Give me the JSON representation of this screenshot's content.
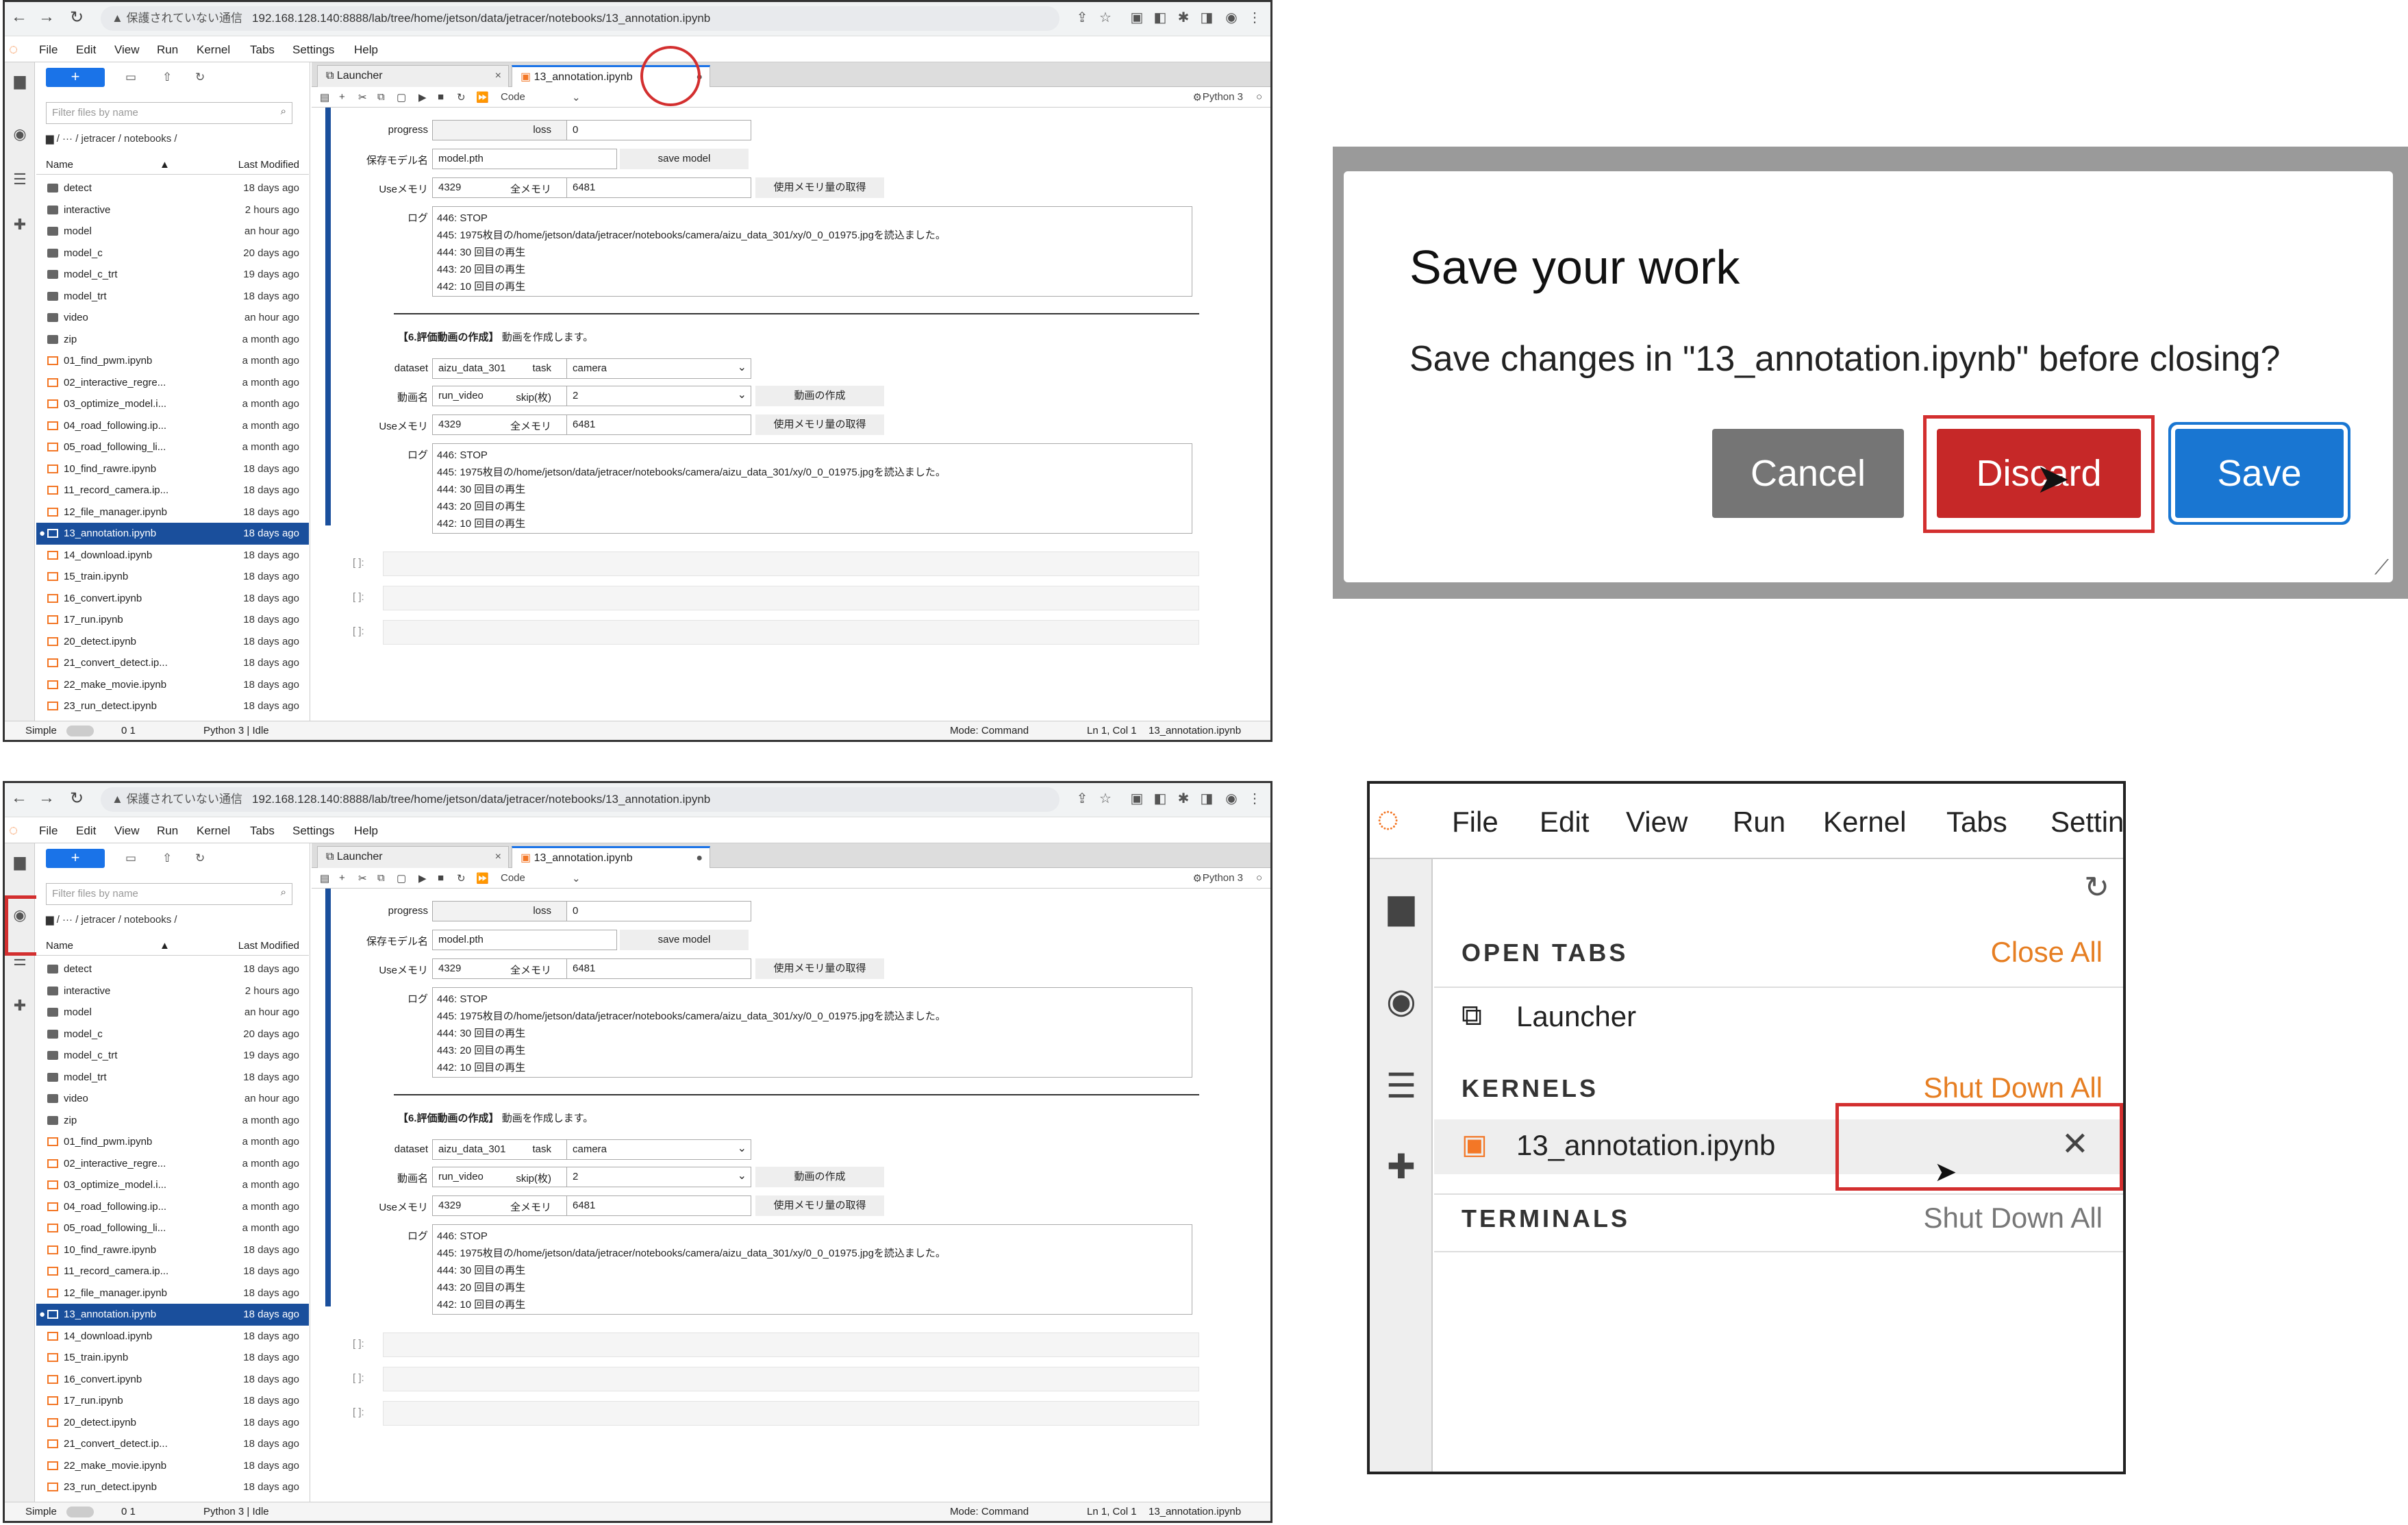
{
  "browser": {
    "url_warning": "▲ 保護されていない通信",
    "url": "192.168.128.140:8888/lab/tree/home/jetson/data/jetracer/notebooks/13_annotation.ipynb"
  },
  "menu": [
    "File",
    "Edit",
    "View",
    "Run",
    "Kernel",
    "Tabs",
    "Settings",
    "Help"
  ],
  "filebrowser": {
    "filter_placeholder": "Filter files by name",
    "breadcrumb": "/ ··· / jetracer / notebooks /",
    "col_name": "Name",
    "col_modified": "Last Modified",
    "files": [
      {
        "name": "detect",
        "modified": "18 days ago",
        "type": "folder"
      },
      {
        "name": "interactive",
        "modified": "2 hours ago",
        "type": "folder"
      },
      {
        "name": "model",
        "modified": "an hour ago",
        "type": "folder"
      },
      {
        "name": "model_c",
        "modified": "20 days ago",
        "type": "folder"
      },
      {
        "name": "model_c_trt",
        "modified": "19 days ago",
        "type": "folder"
      },
      {
        "name": "model_trt",
        "modified": "18 days ago",
        "type": "folder"
      },
      {
        "name": "video",
        "modified": "an hour ago",
        "type": "folder"
      },
      {
        "name": "zip",
        "modified": "a month ago",
        "type": "folder"
      },
      {
        "name": "01_find_pwm.ipynb",
        "modified": "a month ago",
        "type": "nb"
      },
      {
        "name": "02_interactive_regre...",
        "modified": "a month ago",
        "type": "nb"
      },
      {
        "name": "03_optimize_model.i...",
        "modified": "a month ago",
        "type": "nb"
      },
      {
        "name": "04_road_following.ip...",
        "modified": "a month ago",
        "type": "nb"
      },
      {
        "name": "05_road_following_li...",
        "modified": "a month ago",
        "type": "nb"
      },
      {
        "name": "10_find_rawre.ipynb",
        "modified": "18 days ago",
        "type": "nb"
      },
      {
        "name": "11_record_camera.ip...",
        "modified": "18 days ago",
        "type": "nb"
      },
      {
        "name": "12_file_manager.ipynb",
        "modified": "18 days ago",
        "type": "nb"
      },
      {
        "name": "13_annotation.ipynb",
        "modified": "18 days ago",
        "type": "nb",
        "selected": true
      },
      {
        "name": "14_download.ipynb",
        "modified": "18 days ago",
        "type": "nb"
      },
      {
        "name": "15_train.ipynb",
        "modified": "18 days ago",
        "type": "nb"
      },
      {
        "name": "16_convert.ipynb",
        "modified": "18 days ago",
        "type": "nb"
      },
      {
        "name": "17_run.ipynb",
        "modified": "18 days ago",
        "type": "nb"
      },
      {
        "name": "20_detect.ipynb",
        "modified": "18 days ago",
        "type": "nb"
      },
      {
        "name": "21_convert_detect.ip...",
        "modified": "18 days ago",
        "type": "nb"
      },
      {
        "name": "22_make_movie.ipynb",
        "modified": "18 days ago",
        "type": "nb"
      },
      {
        "name": "23_run_detect.ipynb",
        "modified": "18 days ago",
        "type": "nb"
      }
    ]
  },
  "tabs": {
    "launcher": "Launcher",
    "notebook": "13_annotation.ipynb"
  },
  "toolbar": {
    "celltype": "Code",
    "kernel": "Python 3"
  },
  "notebook": {
    "progress_label": "progress",
    "loss_label": "loss",
    "loss_value": "0",
    "save_model_label": "保存モデル名",
    "save_model_value": "model.pth",
    "save_model_button": "save model",
    "use_mem_label": "Useメモリ",
    "use_mem_value": "4329",
    "total_mem_label": "全メモリ",
    "total_mem_value": "6481",
    "get_mem_button": "使用メモリ量の取得",
    "log_label": "ログ",
    "log_lines": [
      "446: STOP",
      "445: 1975枚目の/home/jetson/data/jetracer/notebooks/camera/aizu_data_301/xy/0_0_01975.jpgを読込ました。",
      "444: 30 回目の再生",
      "443: 20 回目の再生",
      "442: 10 回目の再生"
    ],
    "section_title": "【6.評価動画の作成】",
    "section_desc": "動画を作成します。",
    "dataset_label": "dataset",
    "dataset_value": "aizu_data_301",
    "task_label": "task",
    "task_value": "camera",
    "video_label": "動画名",
    "video_value": "run_video",
    "skip_label": "skip(枚)",
    "skip_value": "2",
    "make_video_button": "動画の作成",
    "empty_prompt": "[ ]:"
  },
  "statusbar": {
    "mode_label": "Simple",
    "counts": "0   1",
    "kernel": "Python 3 | Idle",
    "mode": "Mode: Command",
    "position": "Ln 1, Col 1",
    "file": "13_annotation.ipynb"
  },
  "dialog": {
    "title": "Save your work",
    "message": "Save changes in \"13_annotation.ipynb\" before closing?",
    "cancel": "Cancel",
    "discard": "Discard",
    "save": "Save"
  },
  "zoom": {
    "menu": [
      "File",
      "Edit",
      "View",
      "Run",
      "Kernel",
      "Tabs",
      "Settin"
    ],
    "open_tabs": "OPEN TABS",
    "close_all": "Close All",
    "launcher": "Launcher",
    "kernels": "KERNELS",
    "shutdown_all": "Shut Down All",
    "kernel_item": "13_annotation.ipynb",
    "terminals": "TERMINALS",
    "terminals_shutdown": "Shut Down All"
  },
  "colors": {
    "accent": "#1a73e8",
    "jupyter_orange": "#f37726",
    "highlight_red": "#d32f2f",
    "discard_red": "#c62828",
    "save_blue": "#1976d2",
    "cancel_gray": "#757575"
  }
}
